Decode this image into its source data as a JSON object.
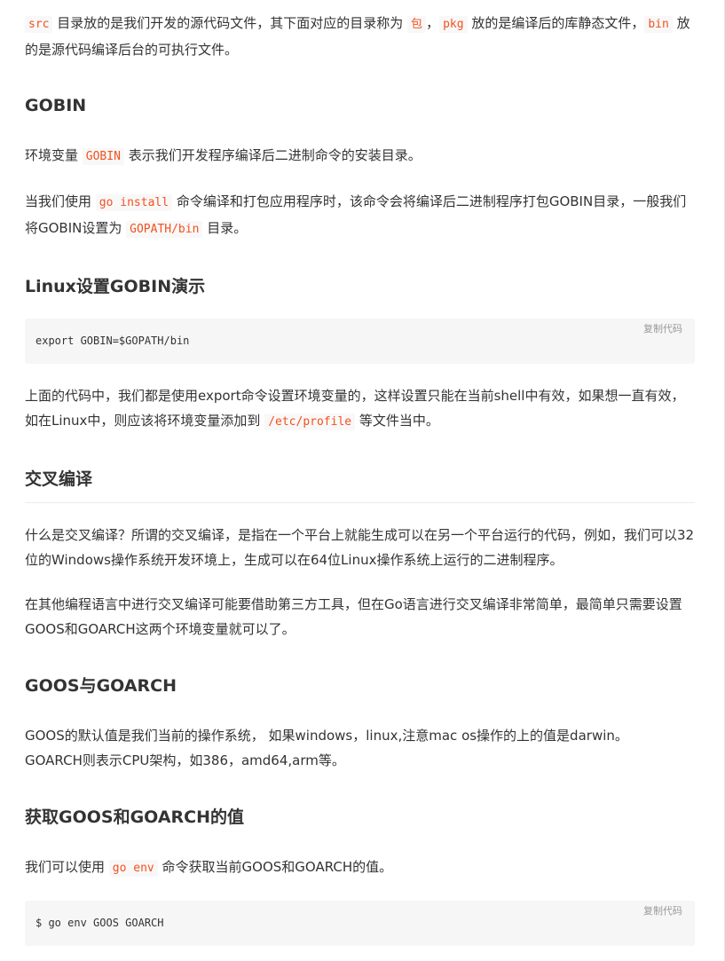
{
  "intro": {
    "code_src": "src",
    "text1": " 目录放的是我们开发的源代码文件，其下面对应的目录称为 ",
    "code_bao": "包",
    "text2": "，",
    "code_pkg": "pkg",
    "text3": " 放的是编译后的库静态文件，",
    "code_bin": "bin",
    "text4": " 放的是源代码编译后台的可执行文件。"
  },
  "gobin": {
    "heading": "GOBIN",
    "p1_text1": "环境变量 ",
    "p1_code": "GOBIN",
    "p1_text2": " 表示我们开发程序编译后二进制命令的安装目录。",
    "p2_text1": "当我们使用 ",
    "p2_code1": "go install",
    "p2_text2": " 命令编译和打包应用程序时，该命令会将编译后二进制程序打包GOBIN目录，一般我们将GOBIN设置为 ",
    "p2_code2": "GOPATH/bin",
    "p2_text3": " 目录。"
  },
  "linux_gobin": {
    "heading": "Linux设置GOBIN演示",
    "code": "export GOBIN=$GOPATH/bin",
    "copy_label": "复制代码",
    "p_text1": "上面的代码中，我们都是使用export命令设置环境变量的，这样设置只能在当前shell中有效，如果想一直有效，如在Linux中，则应该将环境变量添加到 ",
    "p_code": "/etc/profile",
    "p_text2": " 等文件当中。"
  },
  "cross": {
    "heading": "交叉编译",
    "p1": "什么是交叉编译？所谓的交叉编译，是指在一个平台上就能生成可以在另一个平台运行的代码，例如，我们可以32位的Windows操作系统开发环境上，生成可以在64位Linux操作系统上运行的二进制程序。",
    "p2": "在其他编程语言中进行交叉编译可能要借助第三方工具，但在Go语言进行交叉编译非常简单，最简单只需要设置GOOS和GOARCH这两个环境变量就可以了。"
  },
  "goos": {
    "heading": "GOOS与GOARCH",
    "line1": "GOOS的默认值是我们当前的操作系统， 如果windows，linux,注意mac os操作的上的值是darwin。",
    "line2": "GOARCH则表示CPU架构，如386，amd64,arm等。"
  },
  "get_values": {
    "heading": "获取GOOS和GOARCH的值",
    "p_text1": "我们可以使用 ",
    "p_code": "go env",
    "p_text2": " 命令获取当前GOOS和GOARCH的值。",
    "code": "$ go env GOOS GOARCH",
    "copy_label": "复制代码"
  },
  "colors": {
    "inline_code": "#f4511e",
    "text": "#333333",
    "code_bg": "#f6f6f6"
  }
}
